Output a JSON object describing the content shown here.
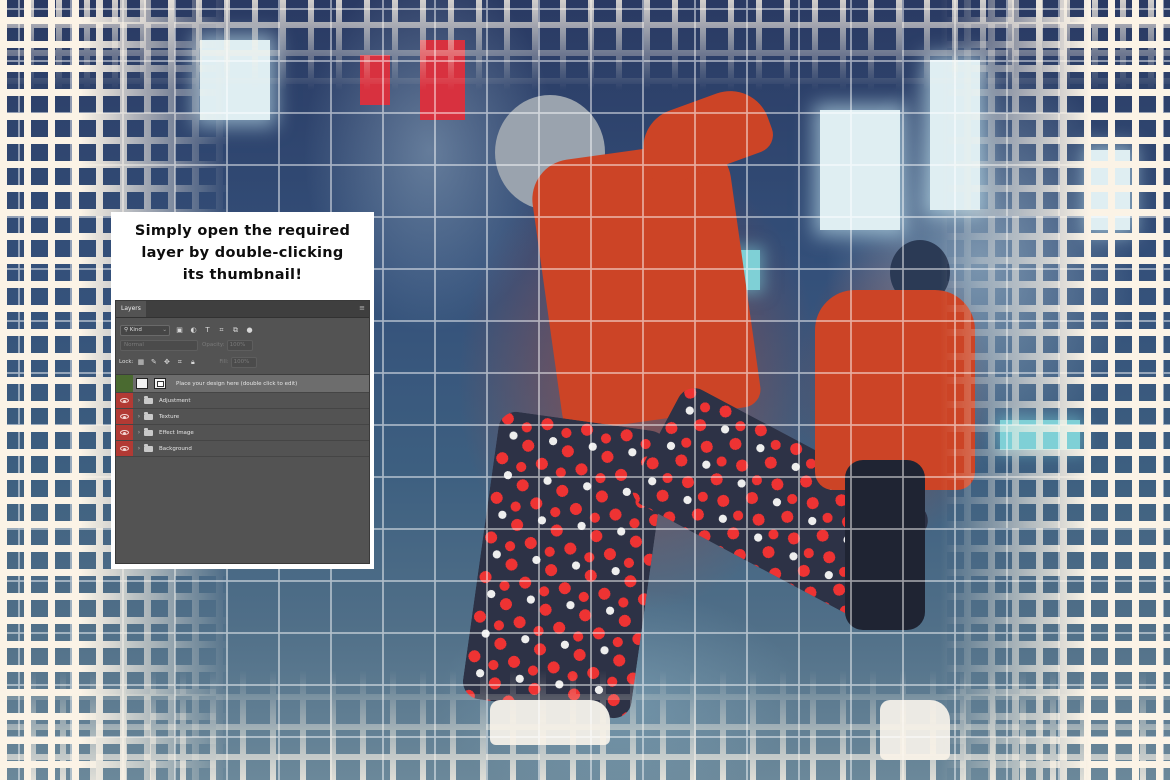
{
  "caption": {
    "line1": "Simply open the required",
    "line2": "layer by double-clicking",
    "line3": "its thumbnail!"
  },
  "panel": {
    "tab_label": "Layers",
    "menu_icon": "hamburger-icon",
    "filter": {
      "kind_label": "Kind",
      "icons": [
        "image-filter-icon",
        "adjustment-filter-icon",
        "type-filter-icon",
        "shape-filter-icon",
        "smart-object-filter-icon",
        "filter-toggle-icon"
      ]
    },
    "blend_mode": "Normal",
    "opacity_label": "Opacity:",
    "opacity_value": "100%",
    "lock_label": "Lock:",
    "fill_label": "Fill:",
    "fill_value": "100%",
    "layers": [
      {
        "name": "Place your design here (double click to edit)",
        "type": "smart-object",
        "eye_color": "#4a6a30",
        "selected": true
      },
      {
        "name": "Adjustment",
        "type": "group",
        "eye_color": "#b23a34",
        "selected": false
      },
      {
        "name": "Texture",
        "type": "group",
        "eye_color": "#b23a34",
        "selected": false
      },
      {
        "name": "Effect Image",
        "type": "group",
        "eye_color": "#b23a34",
        "selected": false
      },
      {
        "name": "Background",
        "type": "group",
        "eye_color": "#b23a34",
        "selected": false
      }
    ]
  },
  "colors": {
    "panel_bg": "#535353",
    "visibility_red": "#b23a34",
    "visibility_green": "#4a6a30",
    "card_bg": "#ffffff",
    "paper_tiles": "#fbf3e6"
  }
}
